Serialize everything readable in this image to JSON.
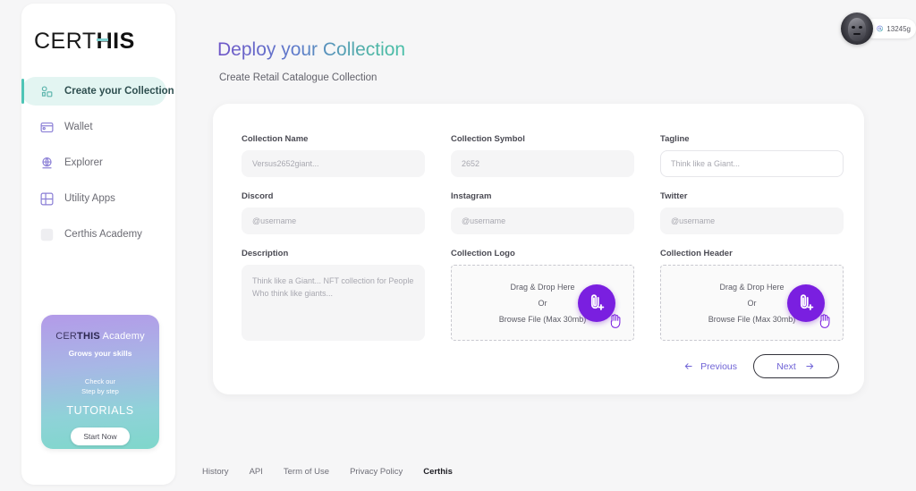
{
  "brand": {
    "logo_light": "CERT",
    "logo_bold": "HIS"
  },
  "sidebar": {
    "items": [
      {
        "label": "Create your Collection",
        "icon": "collection-icon",
        "active": true
      },
      {
        "label": "Wallet",
        "icon": "wallet-icon",
        "active": false
      },
      {
        "label": "Explorer",
        "icon": "globe-icon",
        "active": false
      },
      {
        "label": "Utility Apps",
        "icon": "grid-apps-icon",
        "active": false
      },
      {
        "label": "Certhis Academy",
        "icon": "academy-icon",
        "active": false
      }
    ],
    "promo": {
      "title_light": "CER",
      "title_bold": "THIS",
      "title_tail": " Academy",
      "subtitle": "Grows your skills",
      "line1": "Check our",
      "line2": "Step by step",
      "tutorials": "TUTORIALS",
      "button": "Start Now"
    }
  },
  "user": {
    "handle": "13245g",
    "at_icon": "at-icon",
    "avatar": "avatar"
  },
  "header": {
    "title": "Deploy your Collection",
    "subtitle": "Create Retail Catalogue Collection"
  },
  "form": {
    "collection_name": {
      "label": "Collection Name",
      "placeholder": "Versus2652giant...",
      "value": ""
    },
    "collection_symbol": {
      "label": "Collection Symbol",
      "placeholder": "2652",
      "value": ""
    },
    "tagline": {
      "label": "Tagline",
      "placeholder": "Think like a Giant...",
      "value": ""
    },
    "discord": {
      "label": "Discord",
      "placeholder": "@username",
      "value": ""
    },
    "instagram": {
      "label": "Instagram",
      "placeholder": "@username",
      "value": ""
    },
    "twitter": {
      "label": "Twitter",
      "placeholder": "@username",
      "value": ""
    },
    "description": {
      "label": "Description",
      "placeholder": "Think like a Giant... NFT collection for People Who think like giants...",
      "value": ""
    },
    "collection_logo": {
      "label": "Collection Logo",
      "drag_text": "Drag & Drop Here",
      "or_text": "Or",
      "browse_text": "Browse File (Max 30mb)",
      "upload_icon": "attach-plus-icon",
      "cursor_icon": "hand-cursor-icon"
    },
    "collection_header": {
      "label": "Collection Header",
      "drag_text": "Drag & Drop Here",
      "or_text": "Or",
      "browse_text": "Browse File (Max 30mb)",
      "upload_icon": "attach-plus-icon",
      "cursor_icon": "hand-cursor-icon"
    }
  },
  "actions": {
    "previous": "Previous",
    "previous_icon": "arrow-left-icon",
    "next": "Next",
    "next_icon": "arrow-right-icon"
  },
  "footer": {
    "links": [
      {
        "label": "History",
        "strong": false
      },
      {
        "label": "API",
        "strong": false
      },
      {
        "label": "Term of Use",
        "strong": false
      },
      {
        "label": "Privacy Policy",
        "strong": false
      },
      {
        "label": "Certhis",
        "strong": true
      }
    ]
  },
  "colors": {
    "accent_purple": "#7a1fe0",
    "accent_teal": "#4ec5b6",
    "link_purple": "#6f63d6",
    "active_bg": "#e3f5f2",
    "page_bg": "#f6f6f7",
    "card_bg": "#ffffff"
  }
}
